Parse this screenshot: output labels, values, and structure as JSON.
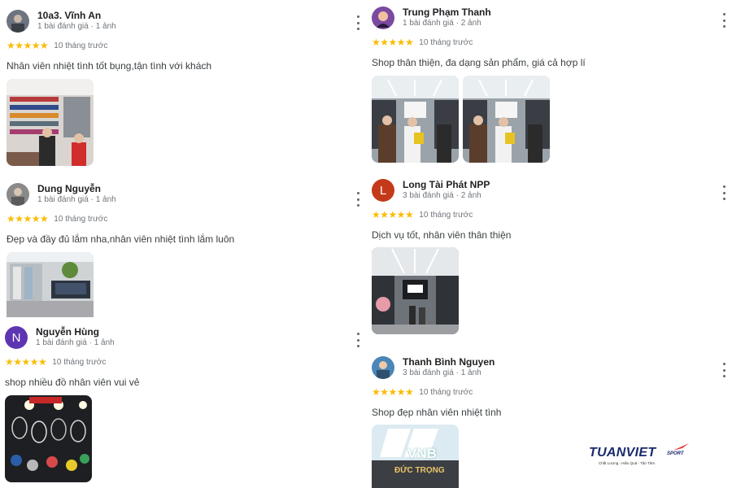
{
  "reviews": [
    {
      "name": "10a3. Vĩnh An",
      "meta": "1 bài đánh giá · 1 ảnh",
      "stars": "★★★★★",
      "date": "10 tháng trước",
      "text": "Nhân viên nhiệt tình tốt bụng,tận tình với khách",
      "avatar_color": "#6d7480",
      "photos": [
        "shoe-shelves-photo"
      ]
    },
    {
      "name": "Trung Phạm Thanh",
      "meta": "1 bài đánh giá · 2 ảnh",
      "stars": "★★★★★",
      "date": "10 tháng trước",
      "text": "Shop thân thiện, đa dạng sản phẩm, giá cả hợp lí",
      "avatar_color": "#7b4aa0",
      "photos": [
        "store-interior-photo",
        "store-interior-photo"
      ]
    },
    {
      "name": "Dung Nguyễn",
      "meta": "1 bài đánh giá · 1 ảnh",
      "stars": "★★★★★",
      "date": "10 tháng trước",
      "text": "Đẹp và đầy đủ lắm nha,nhân viên nhiệt tình lắm luôn",
      "avatar_color": "#8a8a8a",
      "photos": [
        "merchandise-wall-photo"
      ]
    },
    {
      "name": "Long Tài Phát NPP",
      "meta": "3 bài đánh giá · 2 ảnh",
      "stars": "★★★★★",
      "date": "10 tháng trước",
      "text": "Dịch vụ tốt, nhân viên thân thiện",
      "avatar_letter": "L",
      "avatar_color": "#c5391b",
      "photos": [
        "store-aisle-photo"
      ]
    },
    {
      "name": "Nguyễn Hùng",
      "meta": "1 bài đánh giá · 1 ảnh",
      "stars": "★★★★★",
      "date": "10 tháng trước",
      "text": "shop nhiều đồ nhân viên vui vẻ",
      "avatar_letter": "N",
      "avatar_color": "#5e35b1",
      "photos": [
        "racket-display-photo"
      ]
    },
    {
      "name": "Thanh Bình Nguyen",
      "meta": "3 bài đánh giá · 1 ảnh",
      "stars": "★★★★★",
      "date": "10 tháng trước",
      "text": "Shop đẹp nhân viên nhiệt tình",
      "avatar_color": "#4a86b8",
      "photos": [
        "vnb-storefront-photo"
      ]
    }
  ],
  "storefront_sign": {
    "brand": "VNB",
    "location": "ĐỨC TRỌNG"
  },
  "logo": {
    "main": "TUANVIET",
    "sport": "SPORT",
    "tagline": "Chất Lượng - Hiệu Quả - Tận Tâm"
  },
  "colors": {
    "star": "#fbbc04",
    "name": "#202124",
    "meta": "#70757a",
    "logo_blue": "#1a2a6c",
    "logo_red": "#e53935"
  }
}
